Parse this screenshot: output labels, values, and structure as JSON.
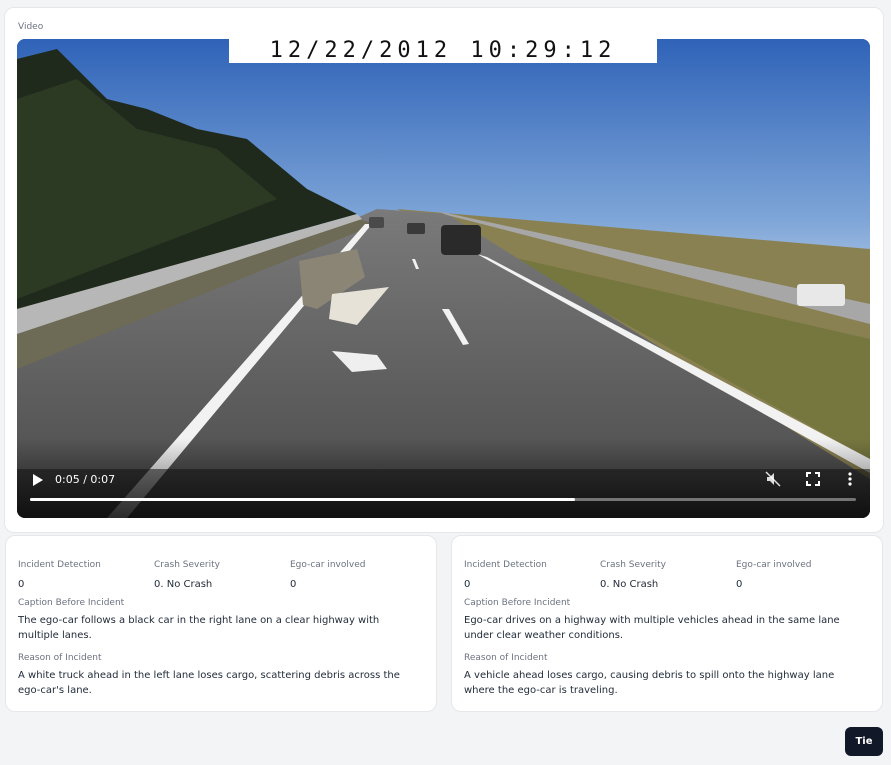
{
  "video": {
    "label": "Video",
    "timestamp_overlay": "12/22/2012 10:29:12",
    "time_display": "0:05 / 0:07",
    "progress_fraction": 0.66,
    "icons": {
      "play": "play-icon",
      "mute": "volume-muted-icon",
      "fullscreen": "fullscreen-icon",
      "more": "more-vertical-icon"
    }
  },
  "results": [
    {
      "fields": [
        {
          "label": "Incident Detection",
          "value": "0"
        },
        {
          "label": "Crash Severity",
          "value": "0. No Crash"
        },
        {
          "label": "Ego-car involved",
          "value": "0"
        }
      ],
      "caption_label": "Caption Before Incident",
      "caption": "The ego-car follows a black car in the right lane on a clear highway with multiple lanes.",
      "reason_label": "Reason of Incident",
      "reason": "A white truck ahead in the left lane loses cargo, scattering debris across the ego-car's lane."
    },
    {
      "fields": [
        {
          "label": "Incident Detection",
          "value": "0"
        },
        {
          "label": "Crash Severity",
          "value": "0. No Crash"
        },
        {
          "label": "Ego-car involved",
          "value": "0"
        }
      ],
      "caption_label": "Caption Before Incident",
      "caption": "Ego-car drives on a highway with multiple vehicles ahead in the same lane under clear weather conditions.",
      "reason_label": "Reason of Incident",
      "reason": "A vehicle ahead loses cargo, causing debris to spill onto the highway lane where the ego-car is traveling."
    }
  ],
  "actions": {
    "tie_label": "Tie"
  },
  "colors": {
    "page_bg": "#f3f4f6",
    "card_bg": "#ffffff",
    "tie_button_bg": "#111827"
  }
}
